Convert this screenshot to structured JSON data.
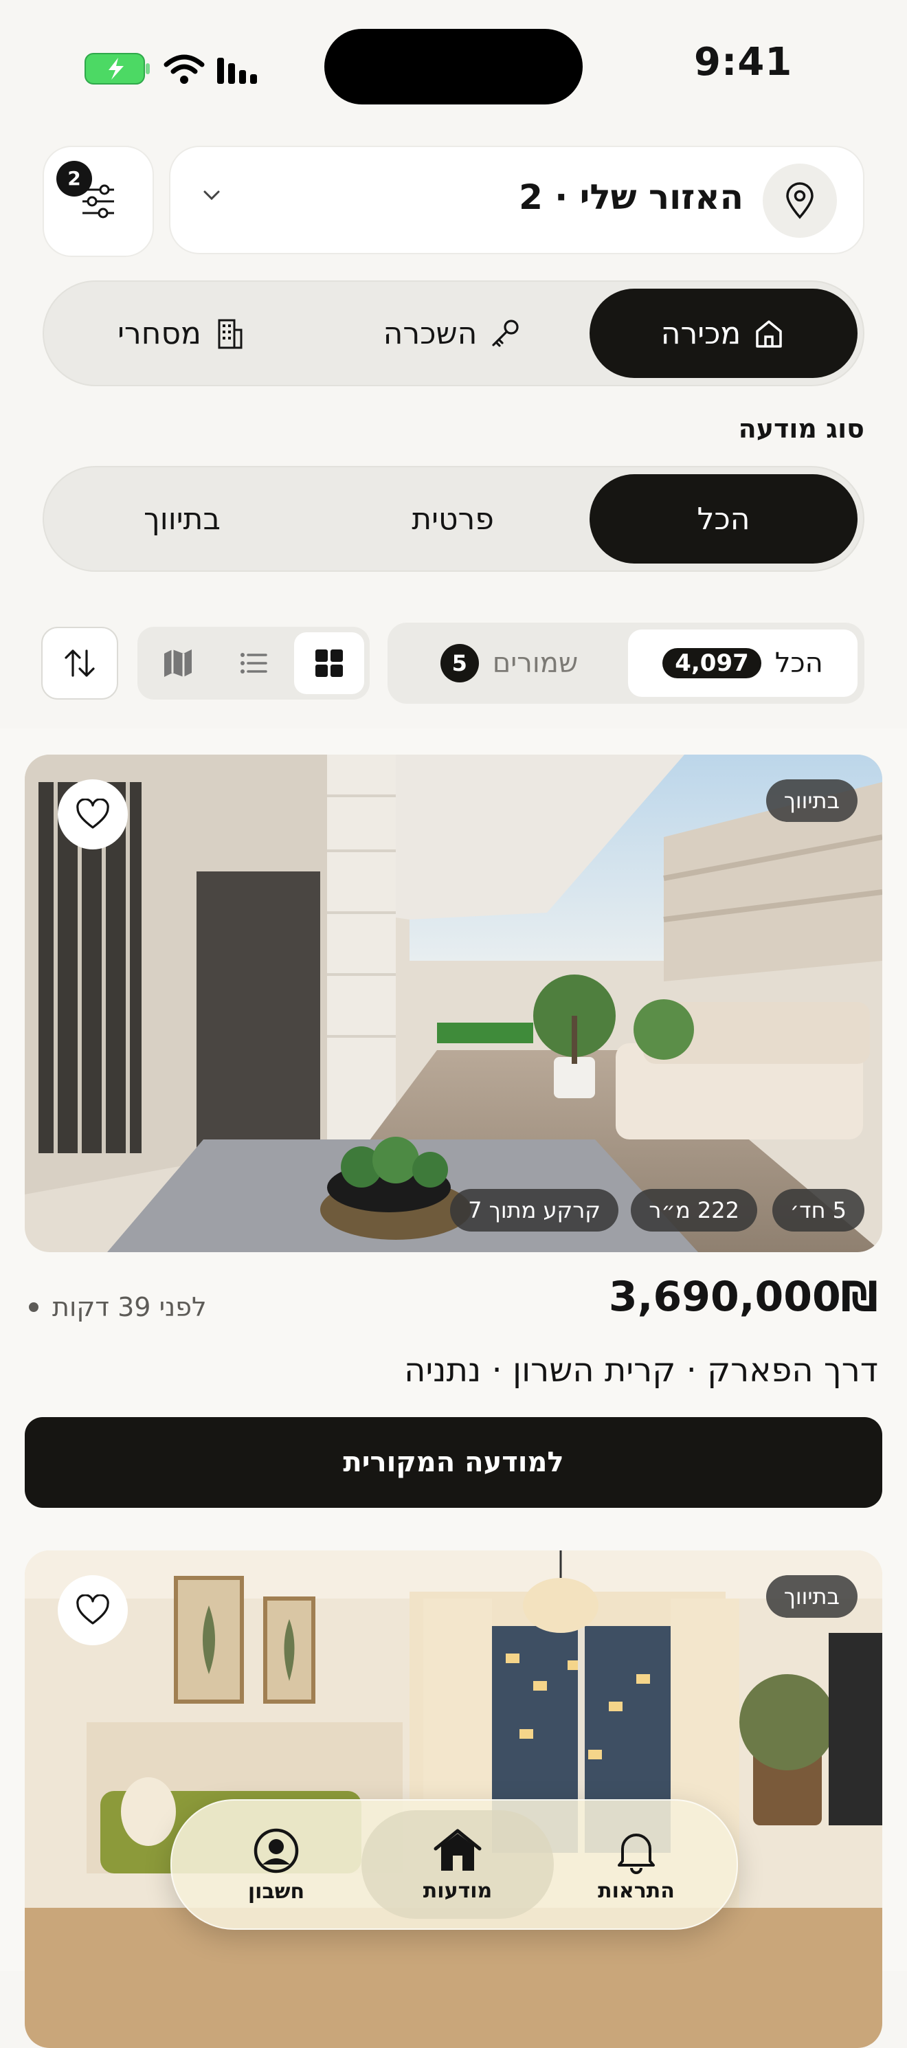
{
  "status_bar": {
    "time": "9:41"
  },
  "header": {
    "filter_badge": "2",
    "location_label": "האזור שלי · 2"
  },
  "deal_types": [
    {
      "label": "מכירה",
      "icon": "house-icon",
      "active": true
    },
    {
      "label": "השכרה",
      "icon": "key-icon",
      "active": false
    },
    {
      "label": "מסחרי",
      "icon": "building-icon",
      "active": false
    }
  ],
  "ad_type": {
    "title": "סוג מודעה",
    "options": [
      {
        "label": "הכל",
        "active": true
      },
      {
        "label": "פרטית",
        "active": false
      },
      {
        "label": "בתיווך",
        "active": false
      }
    ]
  },
  "toolbar": {
    "all_label": "הכל",
    "all_count": "4,097",
    "saved_label": "שמורים",
    "saved_count": "5",
    "view_modes": [
      "grid-icon",
      "list-icon",
      "map-icon"
    ],
    "active_view": "grid-icon"
  },
  "listings": [
    {
      "status": "בתיווך",
      "features": [
        "5 חד׳",
        "222 מ״ר",
        "קרקע מתוך 7"
      ],
      "price": "3,690,000₪",
      "time_ago": "לפני 39 דקות",
      "address": "דרך הפארק · קרית השרון · נתניה",
      "cta": "למודעה המקורית"
    },
    {
      "status": "בתיווך"
    }
  ],
  "tab_bar": [
    {
      "label": "התראות",
      "icon": "bell-icon",
      "active": false
    },
    {
      "label": "מודעות",
      "icon": "home-icon",
      "active": true
    },
    {
      "label": "חשבון",
      "icon": "account-icon",
      "active": false
    }
  ],
  "colors": {
    "primary": "#161512",
    "background": "#f7f6f3",
    "battery": "#4cd964"
  }
}
